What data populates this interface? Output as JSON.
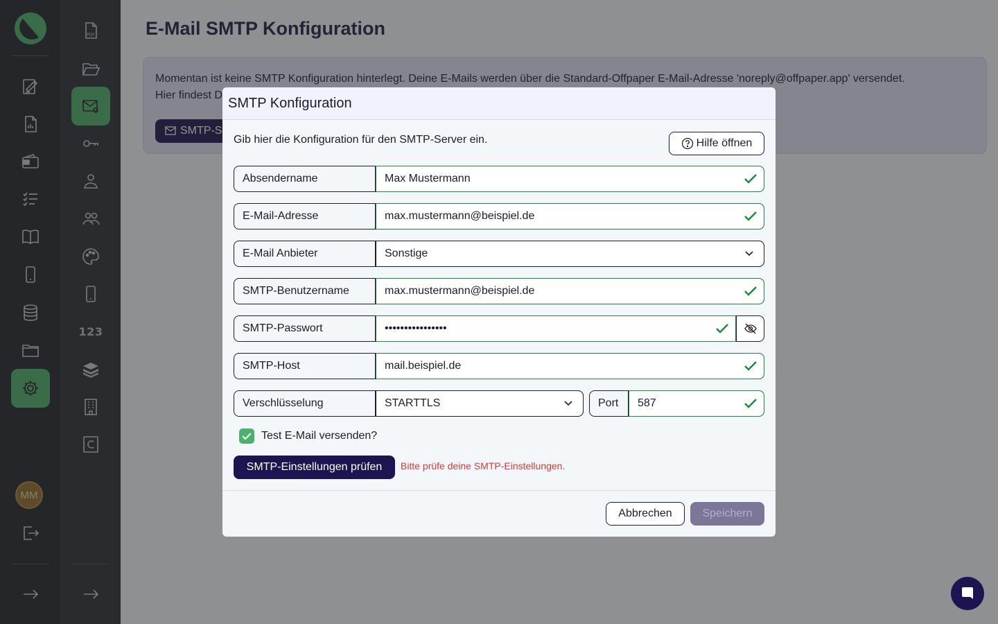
{
  "app": {
    "page_title": "E-Mail SMTP Konfiguration",
    "user_initials": "MM",
    "counter_label": "123"
  },
  "info": {
    "text_line1": "Momentan ist keine SMTP Konfiguration hinterlegt. Deine E-Mails werden über die Standard-Offpaper E-Mail-Adresse 'noreply@offpaper.app' versendet.",
    "text_line2": "Hier findest D",
    "button_label": "SMTP-S"
  },
  "modal": {
    "title": "SMTP Konfiguration",
    "intro": "Gib hier die Konfiguration für den SMTP-Server ein.",
    "help_label": "Hilfe öffnen",
    "fields": {
      "sender_name": {
        "label": "Absendername",
        "value": "Max Mustermann"
      },
      "email": {
        "label": "E-Mail-Adresse",
        "value": "max.mustermann@beispiel.de"
      },
      "provider": {
        "label": "E-Mail Anbieter",
        "value": "Sonstige"
      },
      "username": {
        "label": "SMTP-Benutzername",
        "value": "max.mustermann@beispiel.de"
      },
      "password": {
        "label": "SMTP-Passwort",
        "value": "••••••••••••••••"
      },
      "host": {
        "label": "SMTP-Host",
        "value": "mail.beispiel.de"
      },
      "encryption": {
        "label": "Verschlüsselung",
        "value": "STARTTLS"
      },
      "port": {
        "label": "Port",
        "value": "587"
      }
    },
    "test_email_label": "Test E-Mail versenden?",
    "test_button_label": "SMTP-Einstellungen prüfen",
    "error_text": "Bitte prüfe deine SMTP-Einstellungen.",
    "cancel_label": "Abbrechen",
    "save_label": "Speichern"
  },
  "colors": {
    "accent_green": "#4db06c",
    "brand_navy": "#1d1551",
    "error_red": "#d43b3b"
  }
}
